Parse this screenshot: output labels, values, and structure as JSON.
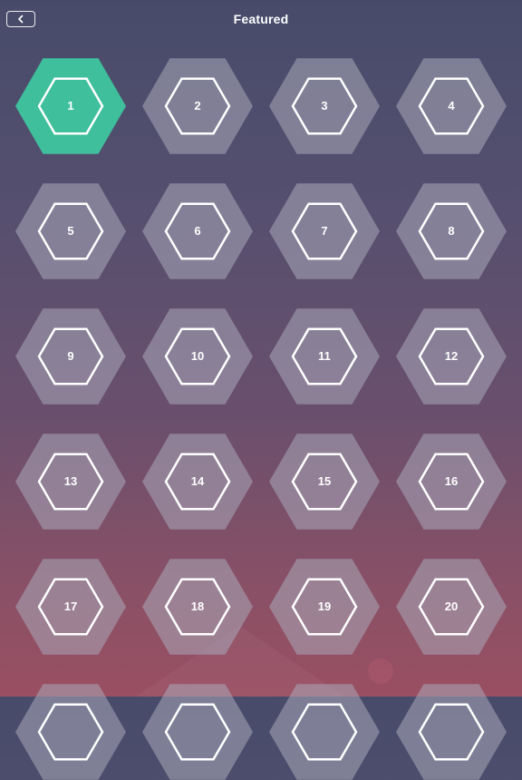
{
  "header": {
    "title": "Featured"
  },
  "colors": {
    "active_fill": "#3fbf9c",
    "locked_fill": "rgba(170,170,185,0.55)",
    "ring": "#ffffff"
  },
  "levels": [
    {
      "label": "1",
      "state": "current"
    },
    {
      "label": "2",
      "state": "locked"
    },
    {
      "label": "3",
      "state": "locked"
    },
    {
      "label": "4",
      "state": "locked"
    },
    {
      "label": "5",
      "state": "locked"
    },
    {
      "label": "6",
      "state": "locked"
    },
    {
      "label": "7",
      "state": "locked"
    },
    {
      "label": "8",
      "state": "locked"
    },
    {
      "label": "9",
      "state": "locked"
    },
    {
      "label": "10",
      "state": "locked"
    },
    {
      "label": "11",
      "state": "locked"
    },
    {
      "label": "12",
      "state": "locked"
    },
    {
      "label": "13",
      "state": "locked"
    },
    {
      "label": "14",
      "state": "locked"
    },
    {
      "label": "15",
      "state": "locked"
    },
    {
      "label": "16",
      "state": "locked"
    },
    {
      "label": "17",
      "state": "locked"
    },
    {
      "label": "18",
      "state": "locked"
    },
    {
      "label": "19",
      "state": "locked"
    },
    {
      "label": "20",
      "state": "locked"
    },
    {
      "label": "",
      "state": "locked"
    },
    {
      "label": "",
      "state": "locked"
    },
    {
      "label": "",
      "state": "locked"
    },
    {
      "label": "",
      "state": "locked"
    }
  ]
}
